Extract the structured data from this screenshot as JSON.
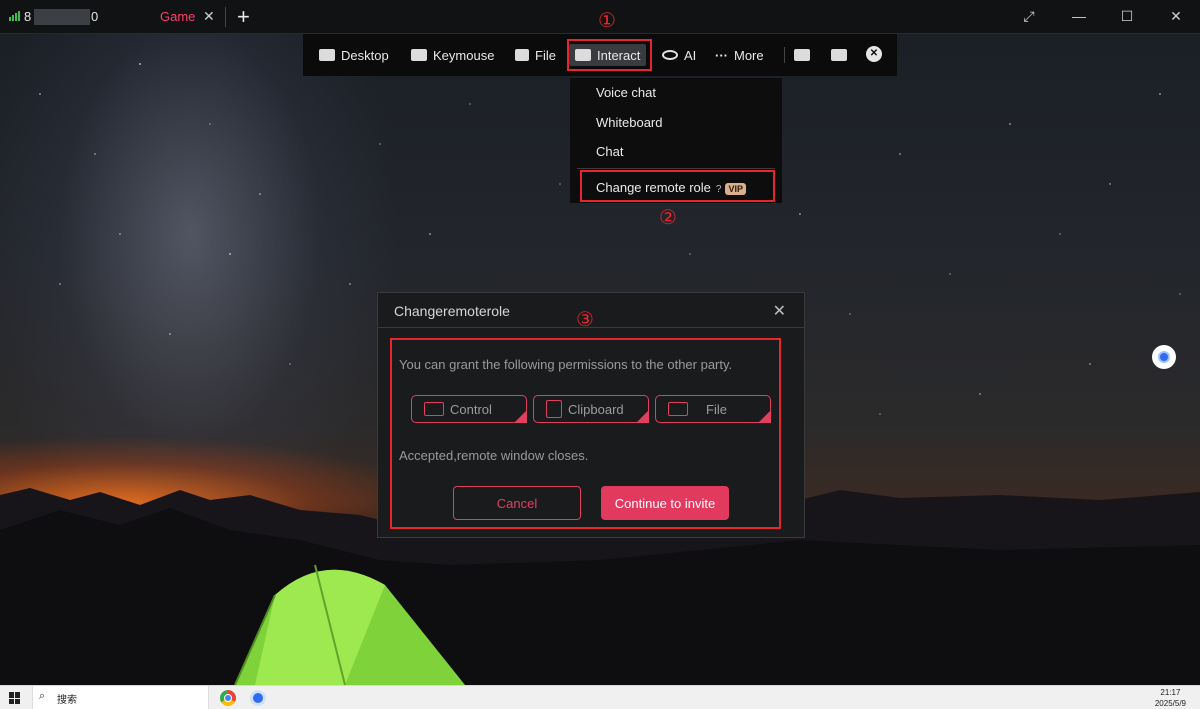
{
  "topbar": {
    "host_prefix": "8",
    "host_suffix": "0",
    "tab_label": "Game",
    "tab_close": "✕",
    "add_tab": "+",
    "fullscreen_icon": "⤢",
    "minimize": "—",
    "maximize": "☐",
    "close": "✕"
  },
  "toolbar": {
    "desktop": "Desktop",
    "keymouse": "Keymouse",
    "file": "File",
    "interact": "Interact",
    "ai": "AI",
    "more": "More",
    "more_glyph": "···",
    "close_glyph": "✕"
  },
  "dropdown": {
    "items": [
      "Voice chat",
      "Whiteboard",
      "Chat"
    ],
    "change_role": "Change remote role",
    "help_glyph": "?",
    "vip": "VIP"
  },
  "annotations": [
    "①",
    "②",
    "③"
  ],
  "dialog": {
    "title": "Changeremoterole",
    "close": "✕",
    "description": "You can grant the following permissions to the other party.",
    "permissions": [
      "Control",
      "Clipboard",
      "File"
    ],
    "note": "Accepted,remote window closes.",
    "cancel": "Cancel",
    "continue": "Continue to invite"
  },
  "taskbar": {
    "search_placeholder": "搜索",
    "time": "21:17",
    "date": "2025/5/9"
  },
  "colors": {
    "accent": "#e23a5e",
    "annotation_red": "#e5262d",
    "signal_green": "#3bbf4a",
    "vip_gold": "#d9b08a"
  }
}
